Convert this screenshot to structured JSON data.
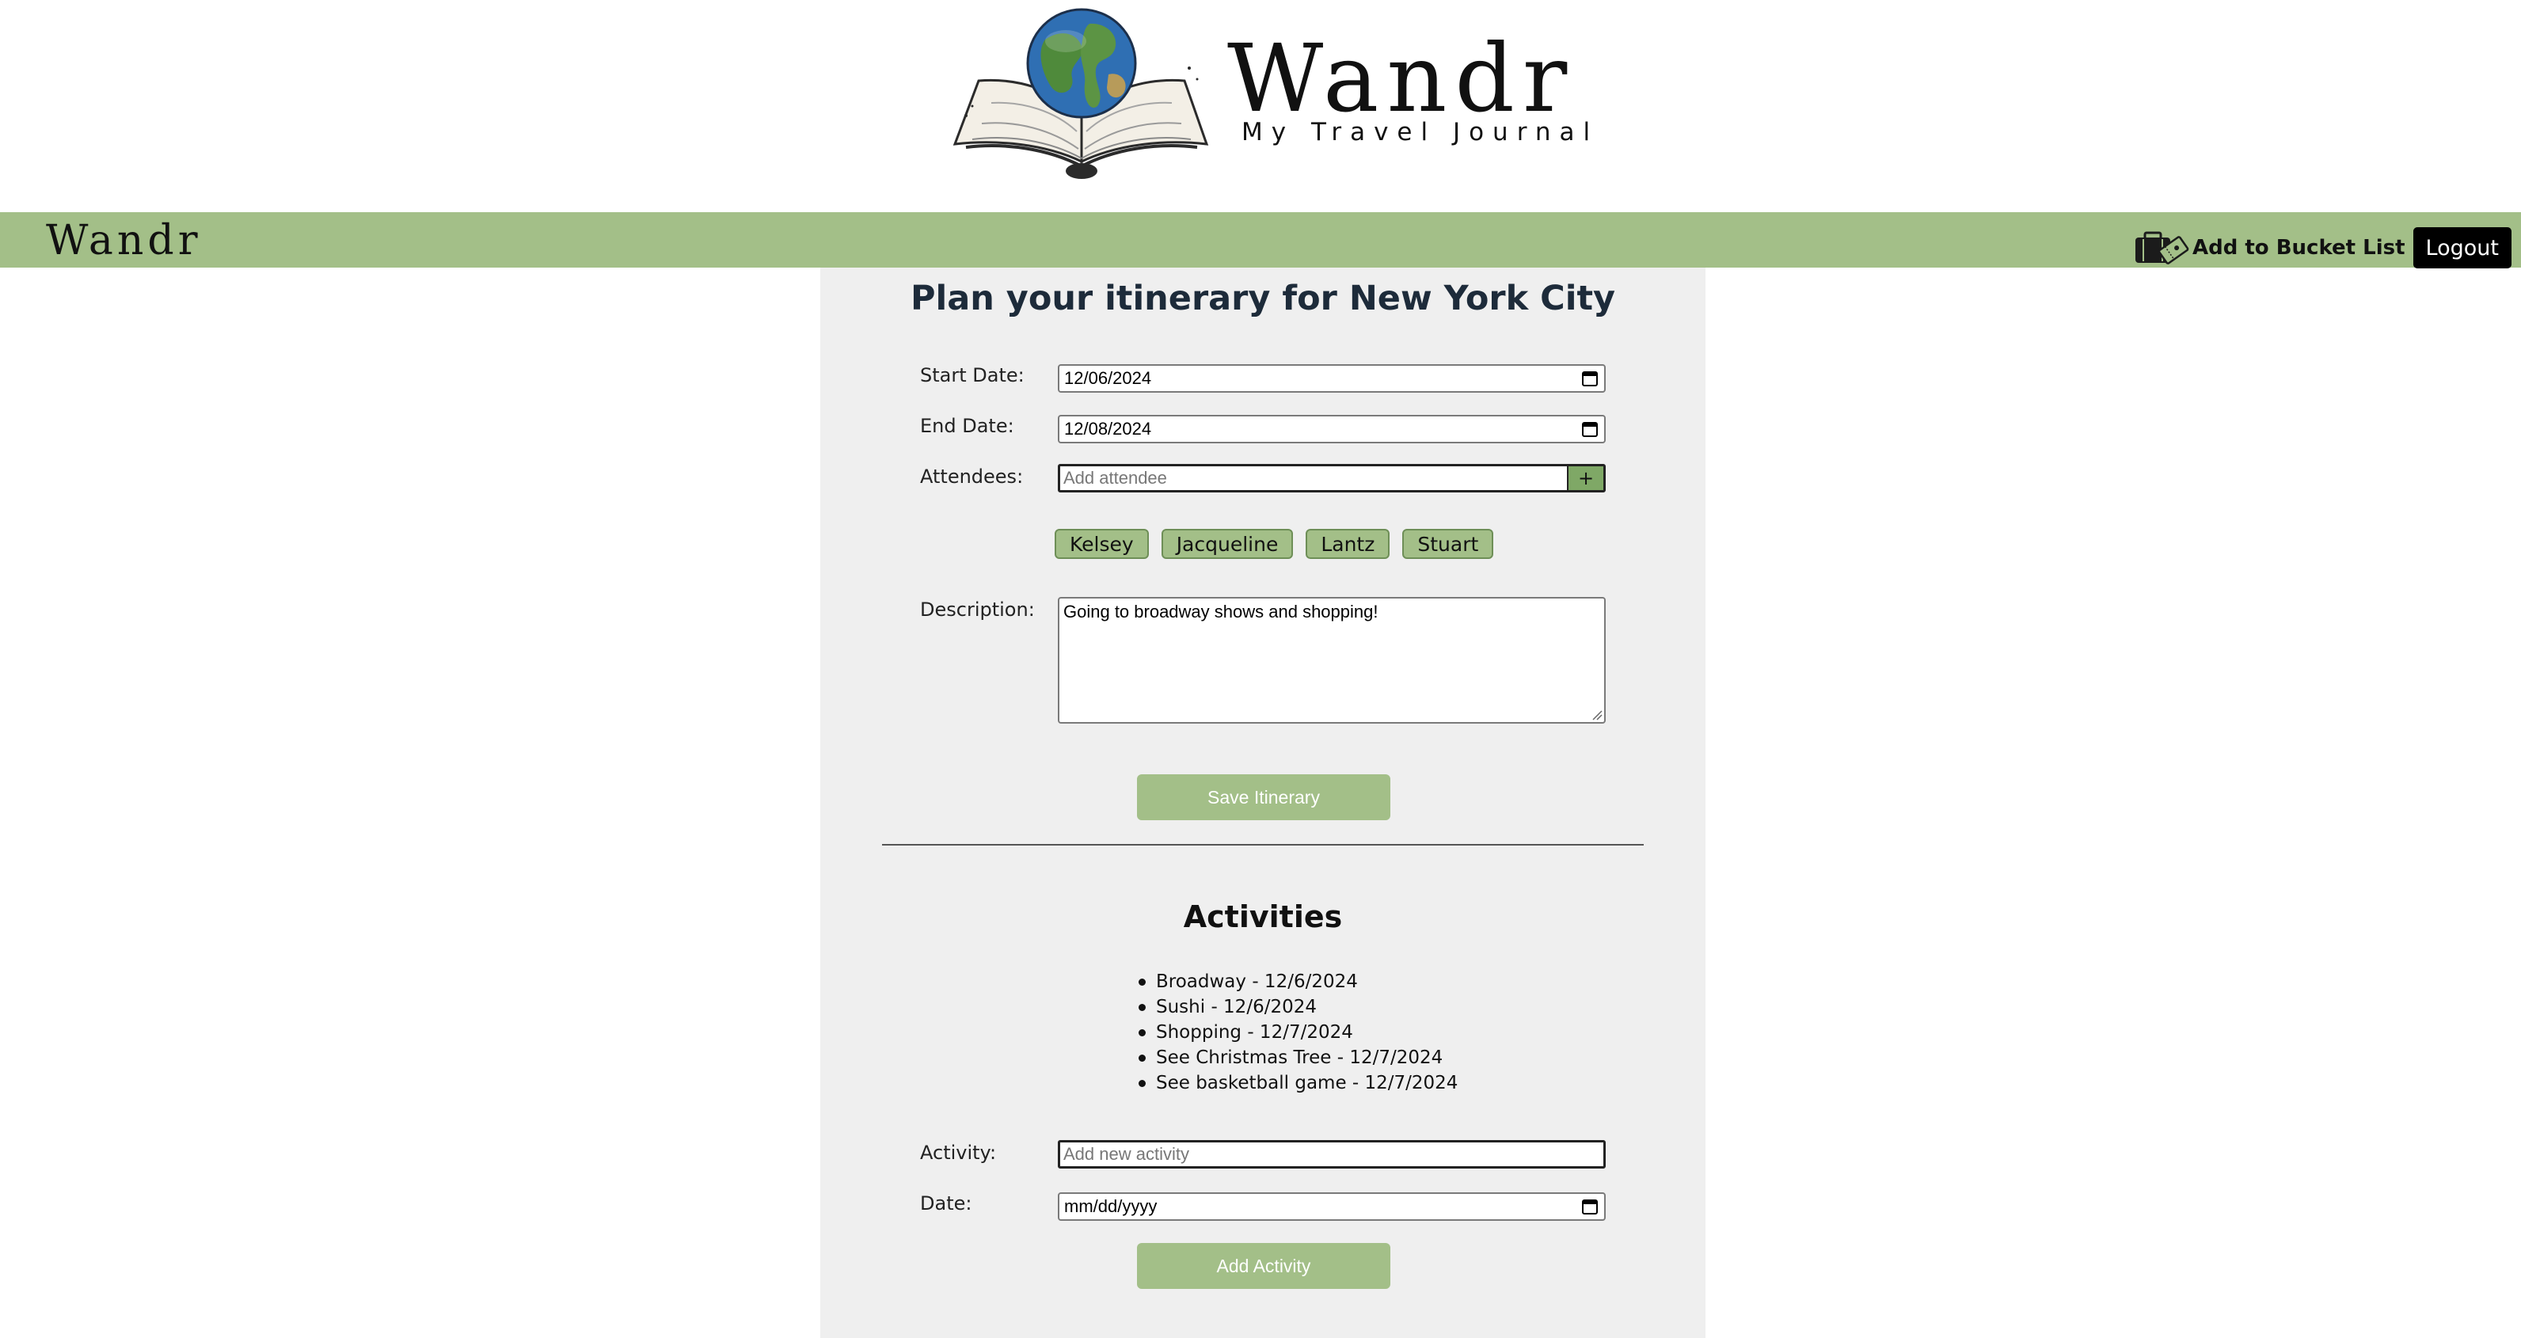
{
  "brand": {
    "logo_wordmark": "Wandr",
    "logo_tagline": "My Travel Journal",
    "nav_brand": "Wandr"
  },
  "nav": {
    "bucket_list_label": "Add to Bucket List",
    "logout_label": "Logout"
  },
  "itinerary": {
    "title": "Plan your itinerary for New York City",
    "start_date_label": "Start Date:",
    "start_date_value": "12/06/2024",
    "end_date_label": "End Date:",
    "end_date_value": "12/08/2024",
    "attendees_label": "Attendees:",
    "attendee_placeholder": "Add attendee",
    "add_attendee_symbol": "+",
    "attendees": [
      "Kelsey",
      "Jacqueline",
      "Lantz",
      "Stuart"
    ],
    "description_label": "Description:",
    "description_value": "Going to broadway shows and shopping!",
    "save_label": "Save Itinerary"
  },
  "activities": {
    "title": "Activities",
    "items": [
      "Broadway - 12/6/2024",
      "Sushi - 12/6/2024",
      "Shopping - 12/7/2024",
      "See Christmas Tree - 12/7/2024",
      "See basketball game - 12/7/2024"
    ],
    "activity_label": "Activity:",
    "activity_placeholder": "Add new activity",
    "date_label": "Date:",
    "date_placeholder": "mm/dd/yyyy",
    "add_label": "Add Activity"
  },
  "colors": {
    "accent": "#a3bf88",
    "accent_dark": "#7fa866",
    "panel": "#efefef",
    "title": "#1d2b3a"
  },
  "icons": {
    "logo": "globe-on-open-book-icon",
    "bucket": "suitcase-ticket-icon",
    "calendar": "calendar-icon"
  }
}
